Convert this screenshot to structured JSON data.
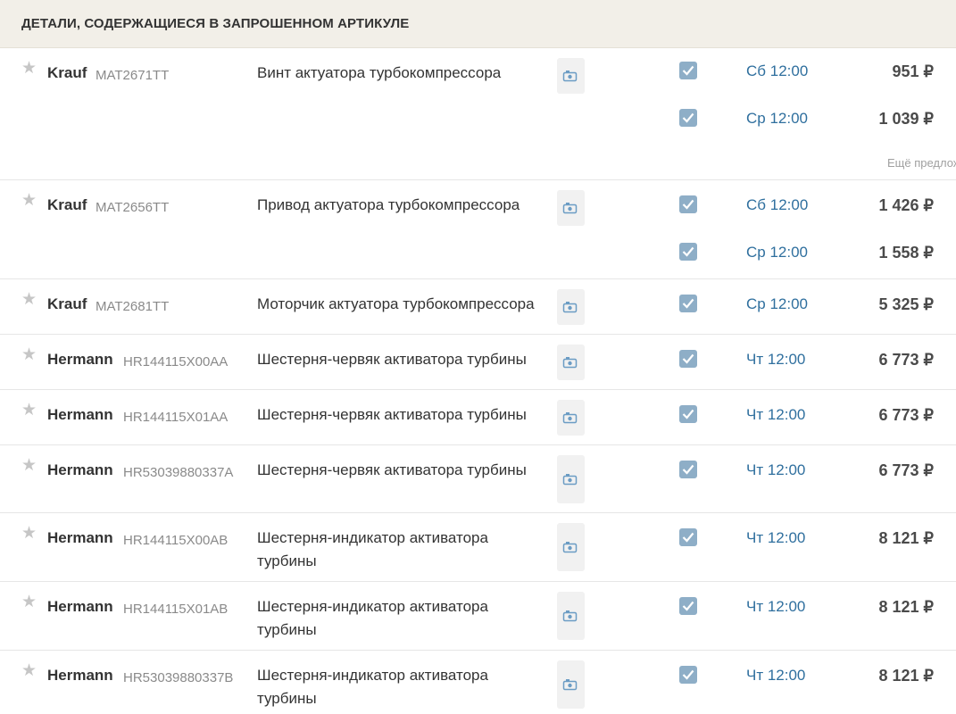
{
  "header": {
    "title": "ДЕТАЛИ, СОДЕРЖАЩИЕСЯ В ЗАПРОШЕННОМ АРТИКУЛЕ"
  },
  "colors": {
    "checkbox": "#8eaec7",
    "date_link": "#2f6f9e",
    "header_bg": "#f2efe8"
  },
  "icons": {
    "favorite": "star-icon",
    "photo": "camera-icon",
    "checked": "check-icon"
  },
  "rows": [
    {
      "brand": "Krauf",
      "article": "MAT2671TT",
      "description": "Винт актуатора турбокомпрессора",
      "offers": [
        {
          "date": "Сб 12:00",
          "price": "951 ₽"
        },
        {
          "date": "Ср 12:00",
          "price": "1 039 ₽"
        }
      ],
      "more": "Ещё предложения"
    },
    {
      "brand": "Krauf",
      "article": "MAT2656TT",
      "description": "Привод актуатора турбокомпрессора",
      "offers": [
        {
          "date": "Сб 12:00",
          "price": "1 426 ₽"
        },
        {
          "date": "Ср 12:00",
          "price": "1 558 ₽"
        }
      ]
    },
    {
      "brand": "Krauf",
      "article": "MAT2681TT",
      "description": "Моторчик актуатора турбокомпрессора",
      "offers": [
        {
          "date": "Ср 12:00",
          "price": "5 325 ₽"
        }
      ]
    },
    {
      "brand": "Hermann",
      "article": "HR144115X00AA",
      "description": "Шестерня-червяк активатора турбины",
      "offers": [
        {
          "date": "Чт 12:00",
          "price": "6 773 ₽"
        }
      ]
    },
    {
      "brand": "Hermann",
      "article": "HR144115X01AA",
      "description": "Шестерня-червяк активатора турбины",
      "offers": [
        {
          "date": "Чт 12:00",
          "price": "6 773 ₽"
        }
      ]
    },
    {
      "brand": "Hermann",
      "article": "HR53039880337A",
      "description": "Шестерня-червяк активатора турбины",
      "offers": [
        {
          "date": "Чт 12:00",
          "price": "6 773 ₽"
        }
      ]
    },
    {
      "brand": "Hermann",
      "article": "HR144115X00AB",
      "description": "Шестерня-индикатор активатора турбины",
      "offers": [
        {
          "date": "Чт 12:00",
          "price": "8 121 ₽"
        }
      ]
    },
    {
      "brand": "Hermann",
      "article": "HR144115X01AB",
      "description": "Шестерня-индикатор активатора турбины",
      "offers": [
        {
          "date": "Чт 12:00",
          "price": "8 121 ₽"
        }
      ]
    },
    {
      "brand": "Hermann",
      "article": "HR53039880337B",
      "description": "Шестерня-индикатор активатора турбины",
      "offers": [
        {
          "date": "Чт 12:00",
          "price": "8 121 ₽"
        }
      ]
    }
  ]
}
